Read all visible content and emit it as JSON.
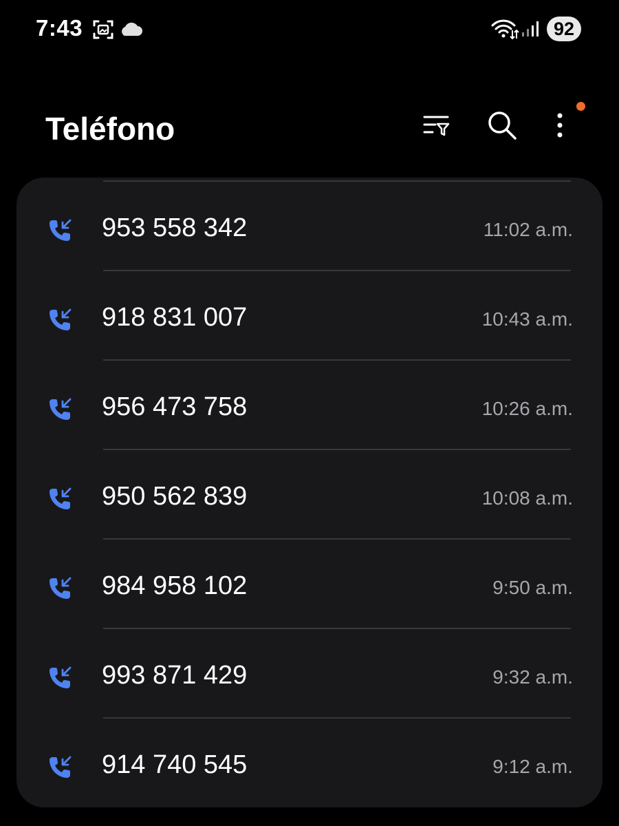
{
  "status_bar": {
    "time": "7:43",
    "battery": "92",
    "icons": [
      "screenshot-icon",
      "cloud-icon",
      "wifi-icon",
      "signal-icon"
    ]
  },
  "header": {
    "title": "Teléfono",
    "actions": [
      "filter-icon",
      "search-icon",
      "more-options-icon"
    ],
    "notification_dot_color": "#f26b2b"
  },
  "colors": {
    "background": "#000000",
    "card": "#18181b",
    "incoming_call_icon": "#4f83f0",
    "secondary_text": "#a7a7ab"
  },
  "calls": [
    {
      "number": "953 558 342",
      "time": "11:02 a.m.",
      "type": "incoming"
    },
    {
      "number": "918 831 007",
      "time": "10:43 a.m.",
      "type": "incoming"
    },
    {
      "number": "956 473 758",
      "time": "10:26 a.m.",
      "type": "incoming"
    },
    {
      "number": "950 562 839",
      "time": "10:08 a.m.",
      "type": "incoming"
    },
    {
      "number": "984 958 102",
      "time": "9:50 a.m.",
      "type": "incoming"
    },
    {
      "number": "993 871 429",
      "time": "9:32 a.m.",
      "type": "incoming"
    },
    {
      "number": "914 740 545",
      "time": "9:12 a.m.",
      "type": "incoming"
    }
  ]
}
